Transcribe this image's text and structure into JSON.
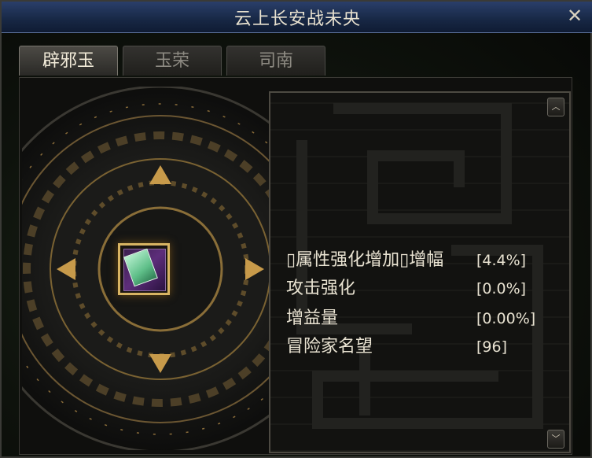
{
  "window": {
    "title": "云上长安战未央"
  },
  "tabs": [
    {
      "label": "辟邪玉",
      "active": true
    },
    {
      "label": "玉荣",
      "active": false
    },
    {
      "label": "司南",
      "active": false
    }
  ],
  "stats": [
    {
      "label": "▯属性强化增加▯增幅",
      "value": "[4.4%]"
    },
    {
      "label": "攻击强化",
      "value": "[0.0%]"
    },
    {
      "label": "增益量",
      "value": "[0.00%]"
    },
    {
      "label": "冒险家名望",
      "value": "[96]"
    }
  ],
  "icons": {
    "close": "close-icon",
    "scroll_up": "chevron-up-icon",
    "scroll_down": "chevron-down-icon",
    "item": "jade-card-icon"
  },
  "colors": {
    "accent_gold": "#d8b463",
    "title_bar": "#172744"
  }
}
